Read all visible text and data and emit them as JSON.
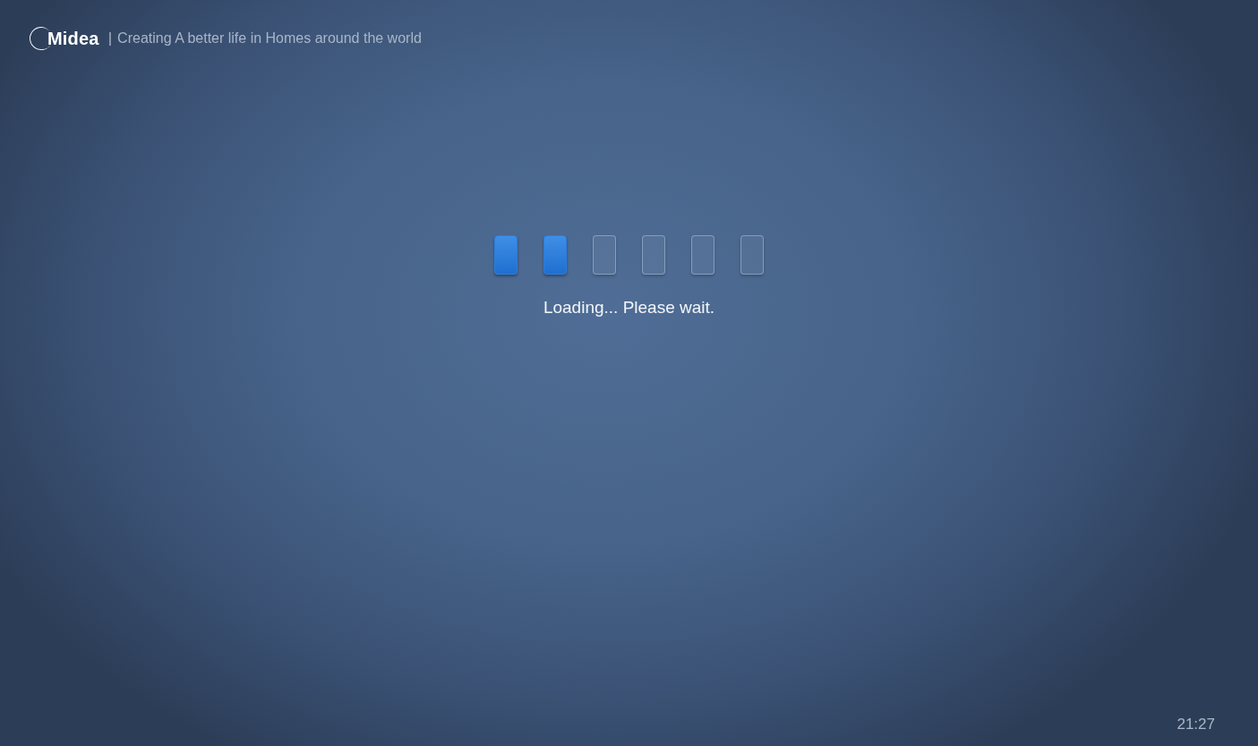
{
  "header": {
    "brand": "Midea",
    "separator": "|",
    "tagline": "Creating A better life in Homes around the world"
  },
  "loader": {
    "segments": [
      {
        "on": true
      },
      {
        "on": true
      },
      {
        "on": false
      },
      {
        "on": false
      },
      {
        "on": false
      },
      {
        "on": false
      }
    ],
    "message": "Loading... Please wait."
  },
  "clock": "21:27"
}
